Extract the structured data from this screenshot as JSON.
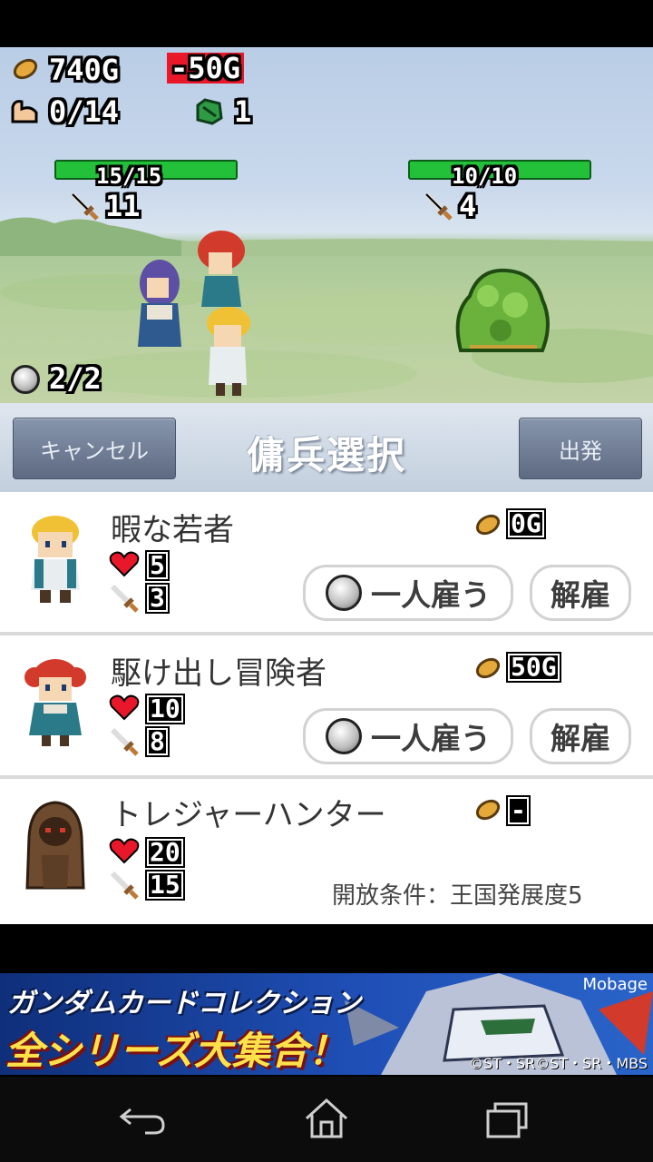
{
  "status": {
    "gold": "740G",
    "gold_delta": "-50G",
    "party": "0/14",
    "gems": "1",
    "hire_count": "2/2"
  },
  "battle": {
    "ally_hp": "15/15",
    "ally_attack": "11",
    "enemy_hp": "10/10",
    "enemy_attack": "4"
  },
  "header": {
    "cancel_label": "キャンセル",
    "title": "傭兵選択",
    "depart_label": "出発"
  },
  "mercenaries": [
    {
      "name": "暇な若者",
      "cost": "0G",
      "hp": "5",
      "attack": "3",
      "hire_label": "一人雇う",
      "dismiss_label": "解雇"
    },
    {
      "name": "駆け出し冒険者",
      "cost": "50G",
      "hp": "10",
      "attack": "8",
      "hire_label": "一人雇う",
      "dismiss_label": "解雇"
    },
    {
      "name": "トレジャーハンター",
      "cost": "-",
      "hp": "20",
      "attack": "15",
      "unlock_condition": "開放条件：王国発展度5"
    }
  ],
  "ad": {
    "line1": "ガンダムカードコレクション",
    "line2": "全シリーズ大集合！",
    "brand": "Mobage",
    "copyright": "©ST・SR©ST・SR・MBS"
  },
  "colors": {
    "hp_bar": "#23c03a",
    "gold_delta_bg": "#e8182a",
    "header_button": "#6c7992"
  },
  "icons": [
    "coin-icon",
    "arm-icon",
    "gem-icon",
    "sword-icon",
    "helmet-icon",
    "heart-icon",
    "back-icon",
    "home-icon",
    "recents-icon"
  ]
}
